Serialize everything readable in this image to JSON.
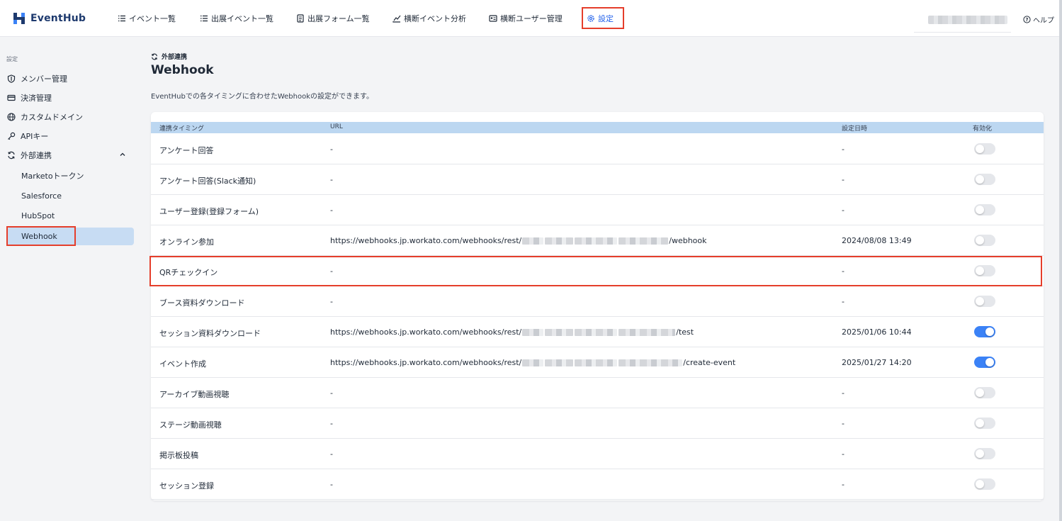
{
  "header": {
    "logo": "EventHub",
    "nav": [
      {
        "label": "イベント一覧",
        "icon": "list-icon"
      },
      {
        "label": "出展イベント一覧",
        "icon": "list-icon"
      },
      {
        "label": "出展フォーム一覧",
        "icon": "form-icon"
      },
      {
        "label": "横断イベント分析",
        "icon": "chart-icon"
      },
      {
        "label": "横断ユーザー管理",
        "icon": "id-card-icon"
      },
      {
        "label": "設定",
        "icon": "gear-icon",
        "active": true
      }
    ],
    "help": "ヘルプ"
  },
  "sidebar": {
    "section": "設定",
    "items": [
      {
        "label": "メンバー管理",
        "icon": "shield-icon"
      },
      {
        "label": "決済管理",
        "icon": "card-icon"
      },
      {
        "label": "カスタムドメイン",
        "icon": "globe-icon"
      },
      {
        "label": "APIキー",
        "icon": "key-icon"
      },
      {
        "label": "外部連携",
        "icon": "sync-icon",
        "expanded": true
      }
    ],
    "sub_items": [
      {
        "label": "Marketoトークン"
      },
      {
        "label": "Salesforce"
      },
      {
        "label": "HubSpot"
      },
      {
        "label": "Webhook",
        "active": true
      }
    ]
  },
  "main": {
    "breadcrumb": "外部連携",
    "title": "Webhook",
    "description": "EventHubでの各タイミングに合わせたWebhookの設定ができます。",
    "table": {
      "headers": [
        "連携タイミング",
        "URL",
        "設定日時",
        "有効化"
      ],
      "rows": [
        {
          "timing": "アンケート回答",
          "url_prefix": "-",
          "url_suffix": "",
          "date": "-",
          "enabled": false
        },
        {
          "timing": "アンケート回答(Slack通知)",
          "url_prefix": "-",
          "url_suffix": "",
          "date": "-",
          "enabled": false
        },
        {
          "timing": "ユーザー登録(登録フォーム)",
          "url_prefix": "-",
          "url_suffix": "",
          "date": "-",
          "enabled": false
        },
        {
          "timing": "オンライン参加",
          "url_prefix": "https://webhooks.jp.workato.com/webhooks/rest/",
          "url_suffix": "/webhook",
          "date": "2024/08/08 13:49",
          "enabled": false
        },
        {
          "timing": "QRチェックイン",
          "url_prefix": "-",
          "url_suffix": "",
          "date": "-",
          "enabled": false
        },
        {
          "timing": "ブース資料ダウンロード",
          "url_prefix": "-",
          "url_suffix": "",
          "date": "-",
          "enabled": false
        },
        {
          "timing": "セッション資料ダウンロード",
          "url_prefix": "https://webhooks.jp.workato.com/webhooks/rest/",
          "url_suffix": "/test",
          "date": "2025/01/06 10:44",
          "enabled": true
        },
        {
          "timing": "イベント作成",
          "url_prefix": "https://webhooks.jp.workato.com/webhooks/rest/",
          "url_suffix": "/create-event",
          "date": "2025/01/27 14:20",
          "enabled": true
        },
        {
          "timing": "アーカイブ動画視聴",
          "url_prefix": "-",
          "url_suffix": "",
          "date": "-",
          "enabled": false
        },
        {
          "timing": "ステージ動画視聴",
          "url_prefix": "-",
          "url_suffix": "",
          "date": "-",
          "enabled": false
        },
        {
          "timing": "掲示板投稿",
          "url_prefix": "-",
          "url_suffix": "",
          "date": "-",
          "enabled": false
        },
        {
          "timing": "セッション登録",
          "url_prefix": "-",
          "url_suffix": "",
          "date": "-",
          "enabled": false
        }
      ]
    }
  },
  "colors": {
    "accent": "#2563eb",
    "highlight": "#e53e2b",
    "toggle_on": "#3b82f6"
  }
}
